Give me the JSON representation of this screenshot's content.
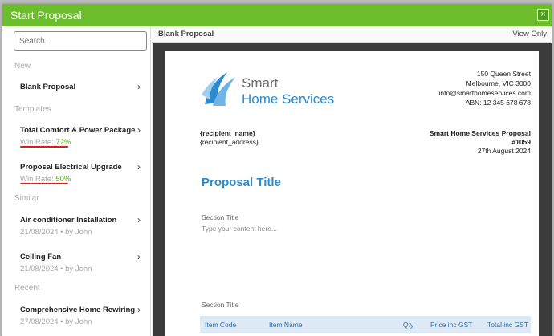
{
  "modal": {
    "title": "Start Proposal",
    "close_glyph": "×"
  },
  "sidebar": {
    "search_placeholder": "Search...",
    "sections": {
      "new": "New",
      "templates": "Templates",
      "similar": "Similar",
      "recent": "Recent"
    },
    "new_items": [
      {
        "title": "Blank Proposal"
      }
    ],
    "templates": [
      {
        "title": "Total Comfort & Power Package",
        "win_label": "Win Rate:",
        "win_value": "72%"
      },
      {
        "title": "Proposal Electrical Upgrade",
        "win_label": "Win Rate:",
        "win_value": "50%"
      }
    ],
    "similar": [
      {
        "title": "Air conditioner Installation",
        "meta": "21/08/2024 • by John"
      },
      {
        "title": "Ceiling Fan",
        "meta": "21/08/2024 • by John"
      }
    ],
    "recent": [
      {
        "title": "Comprehensive Home Rewiring",
        "meta": "27/08/2024 • by John"
      }
    ]
  },
  "main": {
    "header_title": "Blank Proposal",
    "view_mode": "View Only"
  },
  "document": {
    "logo_line1": "Smart",
    "logo_line2": "Home Services",
    "address": [
      "150 Queen Street",
      "Melbourne, VIC 3000",
      "info@smarthomeservices.com",
      "ABN: 12 345 678 678"
    ],
    "recipient_name": "{recipient_name}",
    "recipient_address": "{recipient_address}",
    "proposal_heading": "Smart Home Services Proposal",
    "proposal_number": "#1059",
    "proposal_date": "27th August 2024",
    "proposal_title": "Proposal Title",
    "section1_title": "Section Title",
    "section1_placeholder": "Type your content here...",
    "section2_title": "Section Title",
    "table_headers": [
      "Item Code",
      "Item Name",
      "Qty",
      "Price inc GST",
      "Total inc GST"
    ]
  },
  "colors": {
    "header_green": "#6bbd2c",
    "accent_blue": "#2a8ccf",
    "win_green": "#5fae2a",
    "highlight_red": "#e01b1b"
  }
}
